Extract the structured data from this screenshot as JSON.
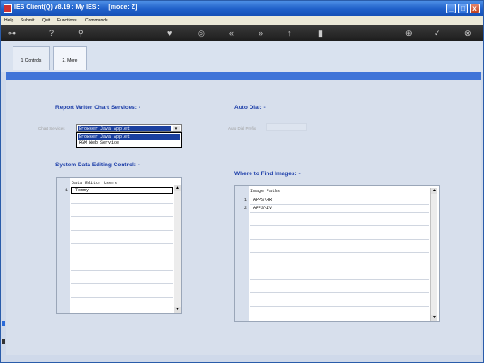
{
  "window": {
    "title": "IES Client(Q) v8.19 : My IES :     [mode: Z]",
    "controls": {
      "minimize": "_",
      "maximize": "□",
      "close": "x"
    }
  },
  "menu": [
    "Help",
    "Submit",
    "Quit",
    "Functions",
    "Commands"
  ],
  "toolbar": {
    "icons": [
      "key-icon",
      "help-icon",
      "search-icon",
      "heart-icon",
      "compass-icon",
      "rewind-icon",
      "fast-forward-icon",
      "up-icon",
      "save-icon",
      "add-icon",
      "check-icon",
      "close-icon"
    ]
  },
  "tabs": [
    {
      "label": "1 Controls",
      "active": false
    },
    {
      "label": "2. More",
      "active": true
    }
  ],
  "report_writer": {
    "heading": "Report Writer Chart Services: -",
    "field_label": "Chart Services",
    "selected_value": "Browser Java Applet",
    "options": [
      "Browser Java Applet",
      "RGM Web Service"
    ]
  },
  "auto_dial": {
    "heading": "Auto Dial: -",
    "field_label": "Auto Dial Prefix",
    "value": ""
  },
  "data_editing": {
    "heading": "System Data Editing Control: -",
    "column_header": "Data Editor Users",
    "rows": [
      {
        "num": "1",
        "value": "Tommy"
      }
    ]
  },
  "images": {
    "heading": "Where to Find Images: -",
    "column_header": "Image Paths",
    "rows": [
      {
        "num": "1",
        "value": "APPS\\HR"
      },
      {
        "num": "2",
        "value": "APPS\\IV"
      }
    ]
  },
  "colors": {
    "heading": "#1a3ca8",
    "titlebar": "#1f5fc8",
    "band": "#3f74d8",
    "selection": "#1a3f9e"
  }
}
